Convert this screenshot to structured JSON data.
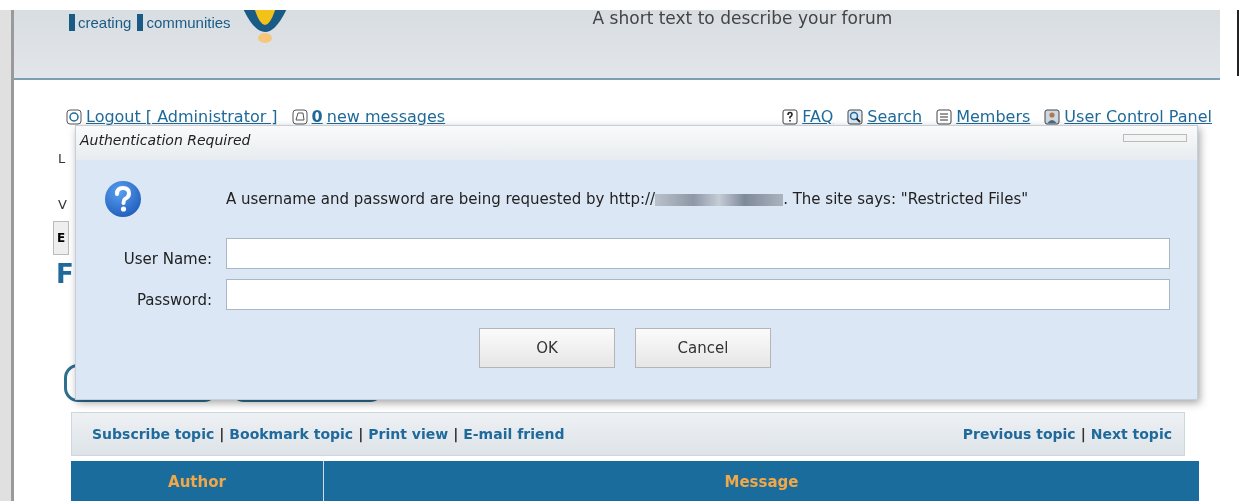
{
  "header": {
    "logo_text": [
      "creating",
      "communities"
    ],
    "description": "A short text to describe your forum"
  },
  "nav_left": [
    {
      "kind": "logout",
      "label": "Logout [ Administrator ]"
    },
    {
      "kind": "messages",
      "count": "0",
      "label": "new messages"
    }
  ],
  "nav_right": [
    {
      "kind": "faq",
      "label": "FAQ"
    },
    {
      "kind": "search",
      "label": "Search"
    },
    {
      "kind": "members",
      "label": "Members"
    },
    {
      "kind": "ucp",
      "label": "User Control Panel"
    }
  ],
  "hidden_fragments": [
    "L",
    "V",
    "E",
    "F"
  ],
  "dialog": {
    "title": "Authentication Required",
    "message_before": "A username and password are being requested by http://",
    "message_after": ". The site says: \"Restricted Files\"",
    "fields": [
      {
        "label": "User Name:"
      },
      {
        "label": "Password:"
      }
    ],
    "buttons": [
      "OK",
      "Cancel"
    ]
  },
  "topic_links_left": [
    "Subscribe topic",
    "Bookmark topic",
    "Print view",
    "E-mail friend"
  ],
  "topic_links_right": [
    "Previous topic",
    "Next topic"
  ],
  "link_separator": "|",
  "table": {
    "columns": [
      "Author",
      "Message"
    ]
  }
}
